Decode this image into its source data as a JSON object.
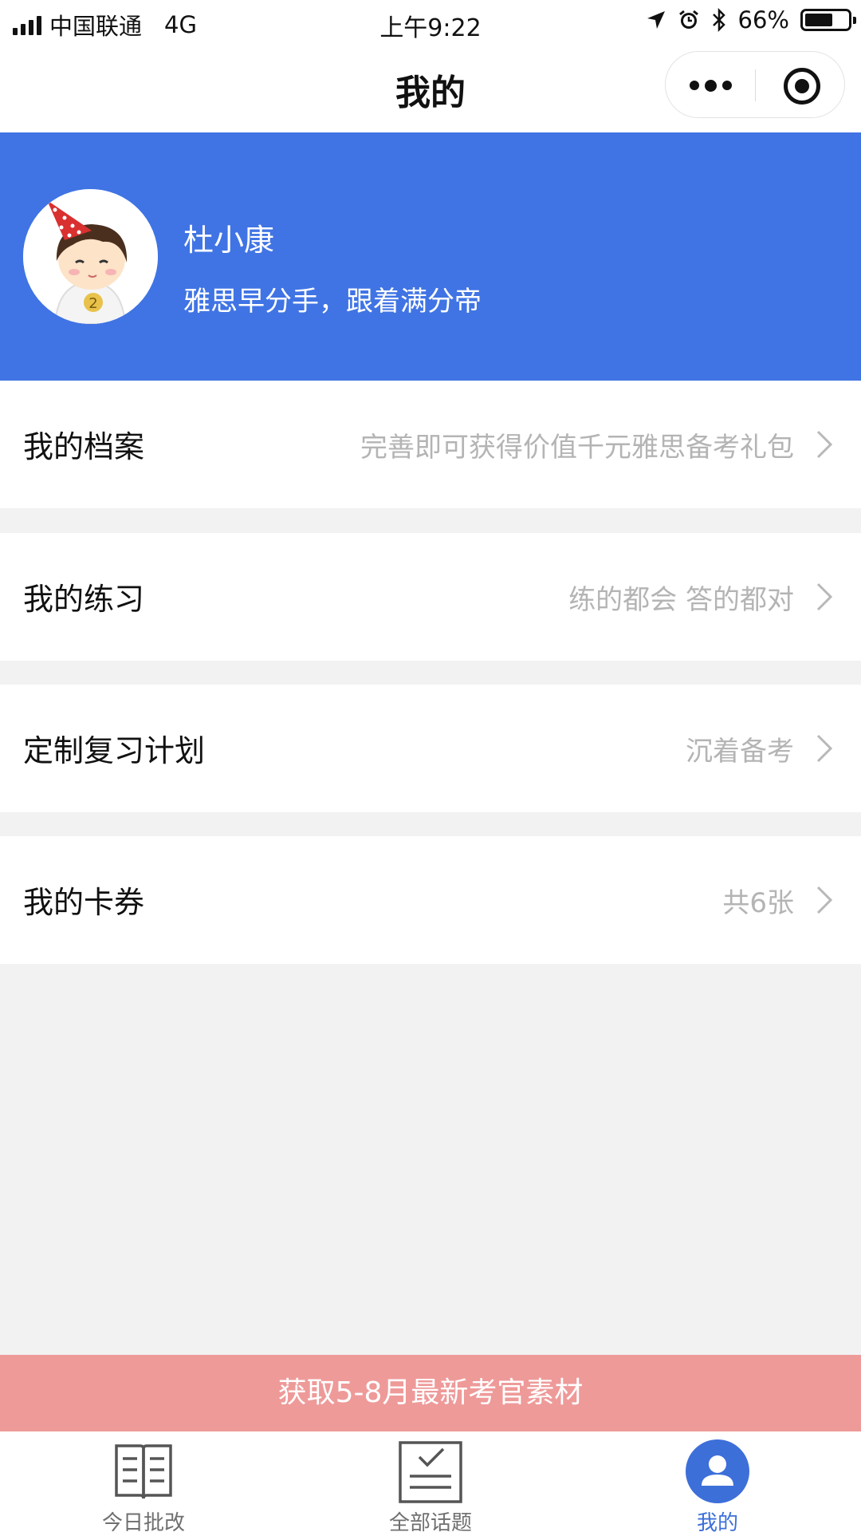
{
  "status_bar": {
    "carrier": "中国联通",
    "network": "4G",
    "time": "上午9:22",
    "battery": "66%",
    "battery_level": 0.66
  },
  "nav": {
    "title": "我的"
  },
  "profile": {
    "name": "杜小康",
    "slogan": "雅思早分手，跟着满分帝"
  },
  "menu": {
    "items": [
      {
        "label": "我的档案",
        "hint": "完善即可获得价值千元雅思备考礼包"
      },
      {
        "label": "我的练习",
        "hint": "练的都会 答的都对"
      },
      {
        "label": "定制复习计划",
        "hint": "沉着备考"
      },
      {
        "label": "我的卡券",
        "hint": "共6张"
      }
    ]
  },
  "promo": {
    "text": "获取5-8月最新考官素材"
  },
  "tabs": [
    {
      "label": "今日批改",
      "icon": "book-icon",
      "active": false
    },
    {
      "label": "全部话题",
      "icon": "checklist-icon",
      "active": false
    },
    {
      "label": "我的",
      "icon": "user-icon",
      "active": true
    }
  ],
  "colors": {
    "header_blue": "#4074e4",
    "promo_pink": "#ee9a99",
    "active_tab": "#3d6fd9",
    "hint_gray": "#b4b4b4"
  }
}
